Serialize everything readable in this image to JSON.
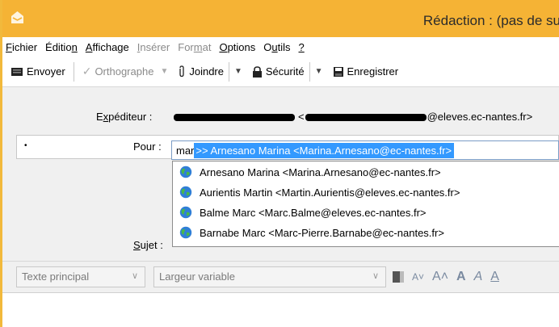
{
  "window": {
    "title": "Rédaction : (pas de su"
  },
  "menu": [
    {
      "label": "Fichier",
      "key": "F",
      "rest": "ichier",
      "pre": "",
      "disabled": false
    },
    {
      "label": "Édition",
      "pre": "Éditio",
      "key": "n",
      "rest": "",
      "disabled": false
    },
    {
      "label": "Affichage",
      "pre": "",
      "key": "A",
      "rest": "ffichage",
      "disabled": false
    },
    {
      "label": "Insérer",
      "pre": "",
      "key": "I",
      "rest": "nsérer",
      "disabled": true
    },
    {
      "label": "Format",
      "pre": "For",
      "key": "m",
      "rest": "at",
      "disabled": true
    },
    {
      "label": "Options",
      "pre": "",
      "key": "O",
      "rest": "ptions",
      "disabled": false
    },
    {
      "label": "Outils",
      "pre": "O",
      "key": "u",
      "rest": "tils",
      "disabled": false
    },
    {
      "label": "?",
      "pre": "",
      "key": "?",
      "rest": "",
      "disabled": false
    }
  ],
  "toolbar": {
    "send": "Envoyer",
    "spelling": "Orthographe",
    "attach": "Joindre",
    "security": "Sécurité",
    "save": "Enregistrer"
  },
  "headers": {
    "from_label": "Expéditeur :",
    "from_suffix": "@eleves.ec-nantes.fr>",
    "to_label": "Pour :",
    "to_typed": "mar",
    "to_suggestion": ">> Arnesano Marina <Marina.Arnesano@ec-nantes.fr>",
    "subject_label": "Sujet :"
  },
  "autocomplete": [
    "Arnesano Marina <Marina.Arnesano@ec-nantes.fr>",
    "Aurientis Martin <Martin.Aurientis@eleves.ec-nantes.fr>",
    "Balme Marc <Marc.Balme@eleves.ec-nantes.fr>",
    "Barnabe Marc <Marc-Pierre.Barnabe@ec-nantes.fr>"
  ],
  "format": {
    "paragraph": "Texte principal",
    "font": "Largeur variable"
  },
  "colors": {
    "titlebar": "#f5b335",
    "selection": "#3399ff"
  }
}
